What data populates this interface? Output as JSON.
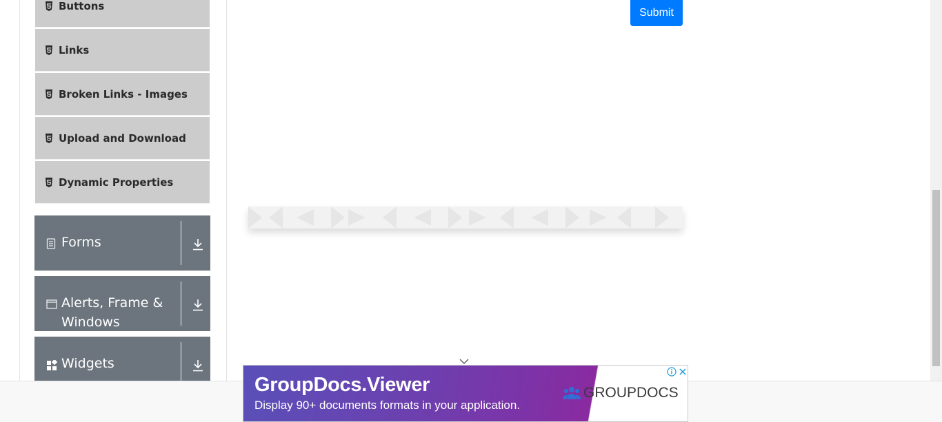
{
  "sidebar": {
    "elements_items": [
      {
        "label": "Buttons",
        "icon": "html5-icon"
      },
      {
        "label": "Links",
        "icon": "html5-icon"
      },
      {
        "label": "Broken Links - Images",
        "icon": "html5-icon"
      },
      {
        "label": "Upload and Download",
        "icon": "html5-icon"
      },
      {
        "label": "Dynamic Properties",
        "icon": "html5-icon"
      }
    ],
    "groups": [
      {
        "label": "Forms",
        "icon": "form-icon"
      },
      {
        "label": "Alerts, Frame & Windows",
        "icon": "window-icon"
      },
      {
        "label": "Widgets",
        "icon": "widgets-icon"
      }
    ]
  },
  "form": {
    "submit_label": "Submit"
  },
  "ad": {
    "title": "GroupDocs.Viewer",
    "subtitle": "Display 90+ documents formats in your application.",
    "brand": "GROUPDOCS"
  },
  "colors": {
    "primary": "#007bff",
    "group_bg": "#6c757d",
    "item_bg": "#cccccc"
  }
}
